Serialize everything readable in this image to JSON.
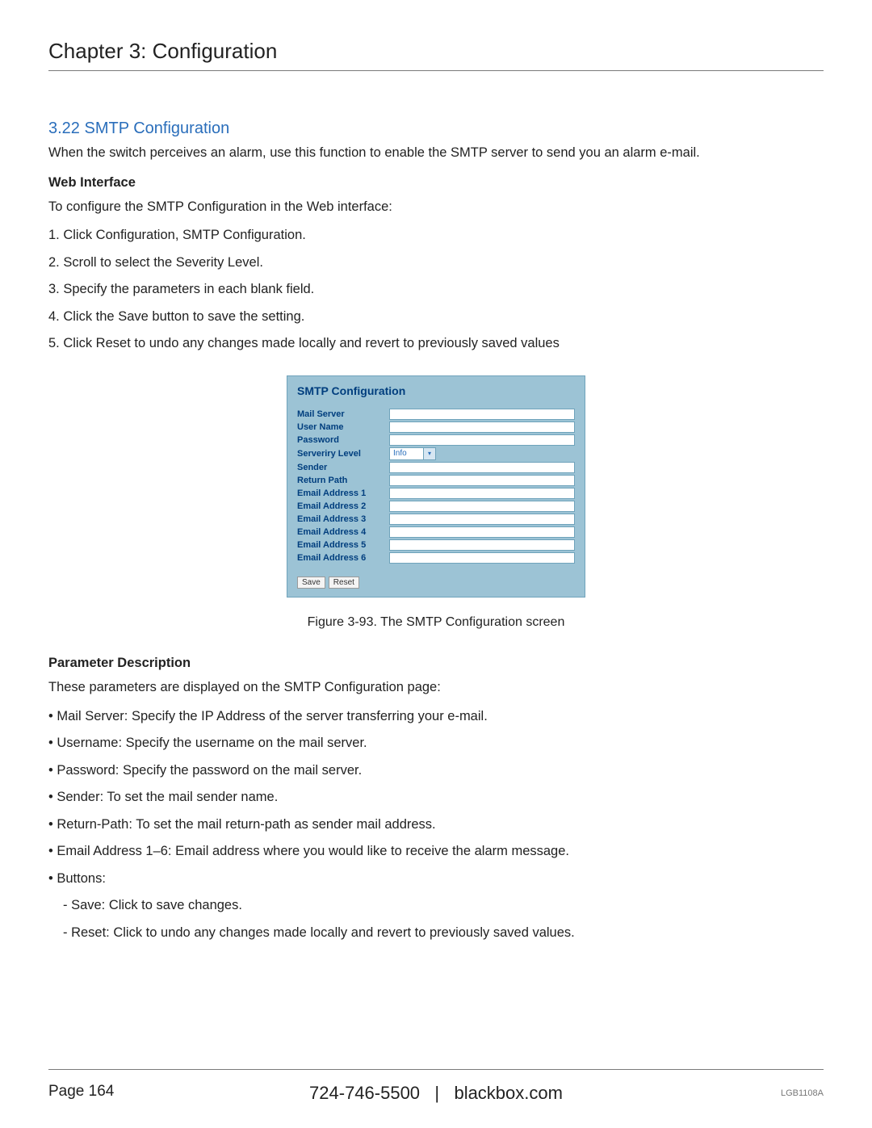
{
  "header": {
    "chapter_title": "Chapter 3: Configuration"
  },
  "section": {
    "title": "3.22 SMTP Configuration",
    "intro": "When the switch perceives an alarm, use this function to enable the SMTP server to send you an alarm e-mail.",
    "web_interface_heading": "Web Interface",
    "web_interface_intro": "To configure the SMTP Configuration in the Web interface:",
    "steps": [
      "1. Click Configuration, SMTP Configuration.",
      "2. Scroll to select the Severity Level.",
      "3. Specify the parameters in each blank field.",
      "4. Click the Save button to save the setting.",
      "5. Click Reset to undo any changes made locally and revert to previously saved values"
    ]
  },
  "figure": {
    "panel_title": "SMTP Configuration",
    "rows": [
      {
        "label": "Mail Server",
        "type": "input"
      },
      {
        "label": "User Name",
        "type": "input"
      },
      {
        "label": "Password",
        "type": "input"
      },
      {
        "label": "Serveriry Level",
        "type": "select",
        "value": "Info"
      },
      {
        "label": "Sender",
        "type": "input"
      },
      {
        "label": "Return Path",
        "type": "input"
      },
      {
        "label": "Email Address 1",
        "type": "input"
      },
      {
        "label": "Email Address 2",
        "type": "input"
      },
      {
        "label": "Email Address 3",
        "type": "input"
      },
      {
        "label": "Email Address 4",
        "type": "input"
      },
      {
        "label": "Email Address 5",
        "type": "input"
      },
      {
        "label": "Email Address 6",
        "type": "input"
      }
    ],
    "buttons": {
      "save": "Save",
      "reset": "Reset"
    },
    "caption": "Figure 3-93. The SMTP Configuration screen"
  },
  "params": {
    "heading": "Parameter Description",
    "intro": "These parameters are displayed on the SMTP Configuration page:",
    "bullets": [
      "• Mail Server: Specify the IP Address of the server transferring your e-mail.",
      "• Username: Specify the username on the mail server.",
      "• Password: Specify the password on the mail server.",
      "• Sender: To set the mail sender name.",
      "• Return-Path: To set the mail return-path as sender mail address.",
      "• Email Address 1–6: Email address where you would like to receive the alarm message.",
      "• Buttons:"
    ],
    "sub_bullets": [
      "- Save: Click to save changes.",
      "- Reset: Click to undo any changes made locally and revert to previously saved values."
    ]
  },
  "footer": {
    "page": "Page 164",
    "phone": "724-746-5500",
    "sep": "|",
    "site": "blackbox.com",
    "model": "LGB1108A"
  }
}
